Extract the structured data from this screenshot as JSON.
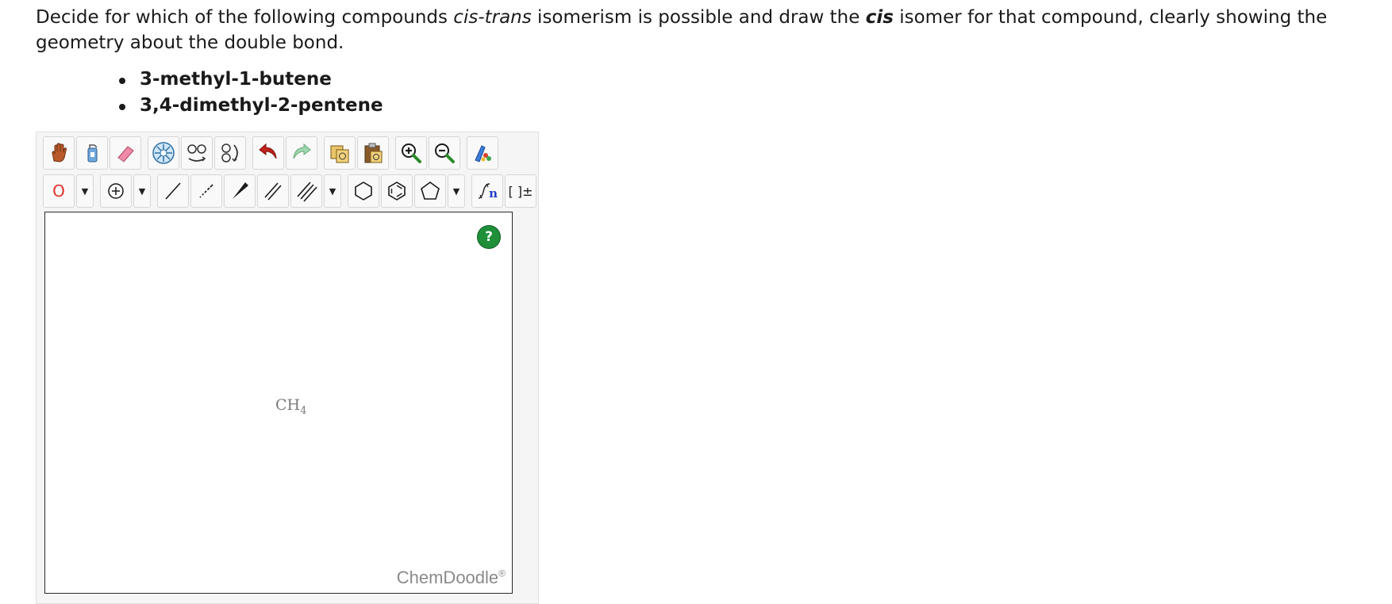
{
  "question": {
    "part1": "Decide for which of the following compounds ",
    "italic1": "cis-trans",
    "part2": " isomerism is possible and draw the ",
    "bold_italic": "cis",
    "part3": " isomer for that compound, clearly showing the geometry about the double bond."
  },
  "compounds": [
    "3-methyl-1-butene",
    "3,4-dimethyl-2-pentene"
  ],
  "toolbar": {
    "row1_icons": [
      "hand-icon",
      "lasso-icon",
      "eraser-icon",
      "center-icon",
      "flip-icon",
      "rotate-icon",
      "undo-icon",
      "redo-icon",
      "copy-icon",
      "paste-icon",
      "zoom-in-icon",
      "zoom-out-icon",
      "clean-icon"
    ],
    "atom_label": "O",
    "sgroup_label": "[ ]±",
    "repeat_label": "n"
  },
  "canvas": {
    "molecule_text": "CH",
    "molecule_subscript": "4",
    "help_label": "?",
    "brand": "ChemDoodle",
    "brand_mark": "®"
  }
}
